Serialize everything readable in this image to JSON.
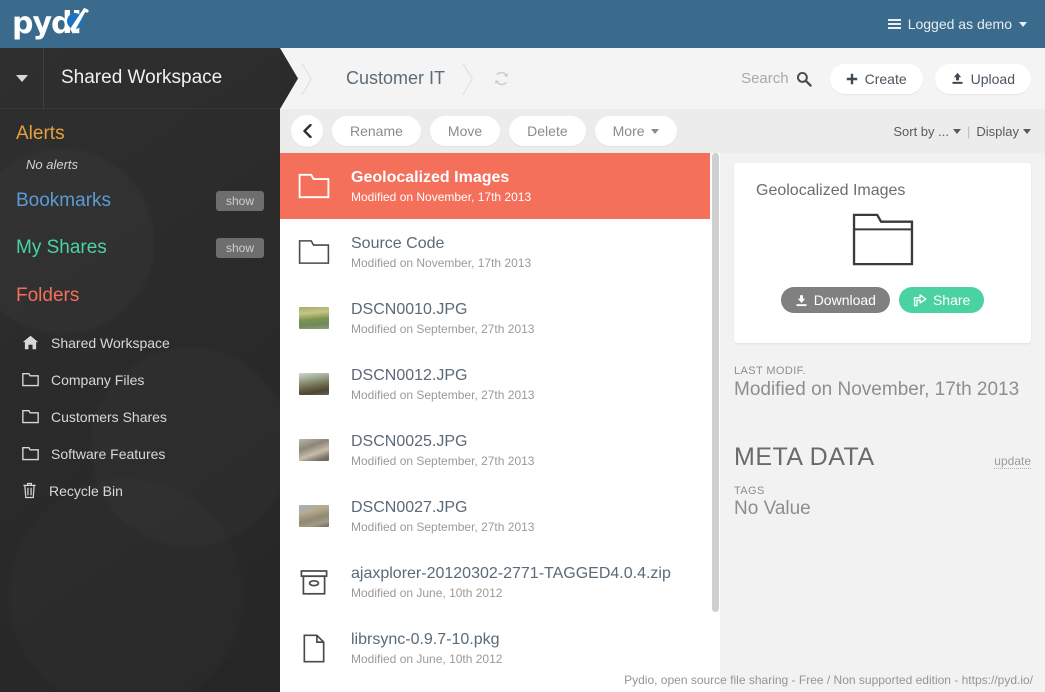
{
  "topbar": {
    "logo_text": "pydi",
    "logo_icon": "pydio-logo",
    "user_menu_label": "Logged as demo",
    "menu_icon": "hamburger-icon",
    "caret_icon": "chevron-down-icon",
    "background_color": "#3a6a8c"
  },
  "sidebar": {
    "workspace_title": "Shared Workspace",
    "workspace_caret_icon": "chevron-down-icon",
    "sections": {
      "alerts": {
        "title": "Alerts",
        "color": "#e8a03c",
        "empty_text": "No alerts"
      },
      "bookmarks": {
        "title": "Bookmarks",
        "color": "#5b9bd5",
        "action_label": "show"
      },
      "my_shares": {
        "title": "My Shares",
        "color": "#4bd2a1",
        "action_label": "show"
      },
      "folders": {
        "title": "Folders",
        "color": "#f4705a"
      }
    },
    "folders": [
      {
        "label": "Shared Workspace",
        "icon": "home-icon"
      },
      {
        "label": "Company Files",
        "icon": "folder-icon"
      },
      {
        "label": "Customers Shares",
        "icon": "folder-icon"
      },
      {
        "label": "Software Features",
        "icon": "folder-icon"
      },
      {
        "label": "Recycle Bin",
        "icon": "trash-icon"
      }
    ]
  },
  "breadcrumb": {
    "current": "Customer IT",
    "refresh_icon": "refresh-icon",
    "search_label": "Search",
    "search_icon": "search-icon",
    "create_label": "Create",
    "create_icon": "plus-icon",
    "upload_label": "Upload",
    "upload_icon": "upload-icon"
  },
  "toolbar": {
    "back_icon": "chevron-left-icon",
    "rename_label": "Rename",
    "move_label": "Move",
    "delete_label": "Delete",
    "more_label": "More",
    "sort_label": "Sort by ...",
    "separator": "|",
    "display_label": "Display"
  },
  "filelist": {
    "items": [
      {
        "name": "Geolocalized Images",
        "date": "Modified on November, 17th 2013",
        "icon": "folder-icon",
        "selected": true
      },
      {
        "name": "Source Code",
        "date": "Modified on November, 17th 2013",
        "icon": "folder-icon",
        "selected": false
      },
      {
        "name": "DSCN0010.JPG",
        "date": "Modified on September, 27th 2013",
        "icon": "image-thumbnail",
        "selected": false
      },
      {
        "name": "DSCN0012.JPG",
        "date": "Modified on September, 27th 2013",
        "icon": "image-thumbnail",
        "selected": false
      },
      {
        "name": "DSCN0025.JPG",
        "date": "Modified on September, 27th 2013",
        "icon": "image-thumbnail",
        "selected": false
      },
      {
        "name": "DSCN0027.JPG",
        "date": "Modified on September, 27th 2013",
        "icon": "image-thumbnail",
        "selected": false
      },
      {
        "name": "ajaxplorer-20120302-2771-TAGGED4.0.4.zip",
        "date": "Modified on June, 10th 2012",
        "icon": "archive-icon",
        "selected": false
      },
      {
        "name": "librsync-0.9.7-10.pkg",
        "date": "Modified on June, 10th 2012",
        "icon": "file-icon",
        "selected": false
      }
    ],
    "selected_color": "#f4705a"
  },
  "detail_panel": {
    "title": "Geolocalized Images",
    "preview_icon": "folder-icon",
    "download_label": "Download",
    "download_icon": "download-icon",
    "share_label": "Share",
    "share_icon": "share-icon",
    "share_color": "#4bd2a1",
    "last_modif_label": "LAST MODIF.",
    "last_modif_value": "Modified on November, 17th 2013",
    "meta_data_label": "META DATA",
    "update_label": "update",
    "tags_label": "TAGS",
    "tags_value": "No Value"
  },
  "footer": {
    "text": "Pydio, open source file sharing - Free / Non supported edition - https://pyd.io/"
  }
}
